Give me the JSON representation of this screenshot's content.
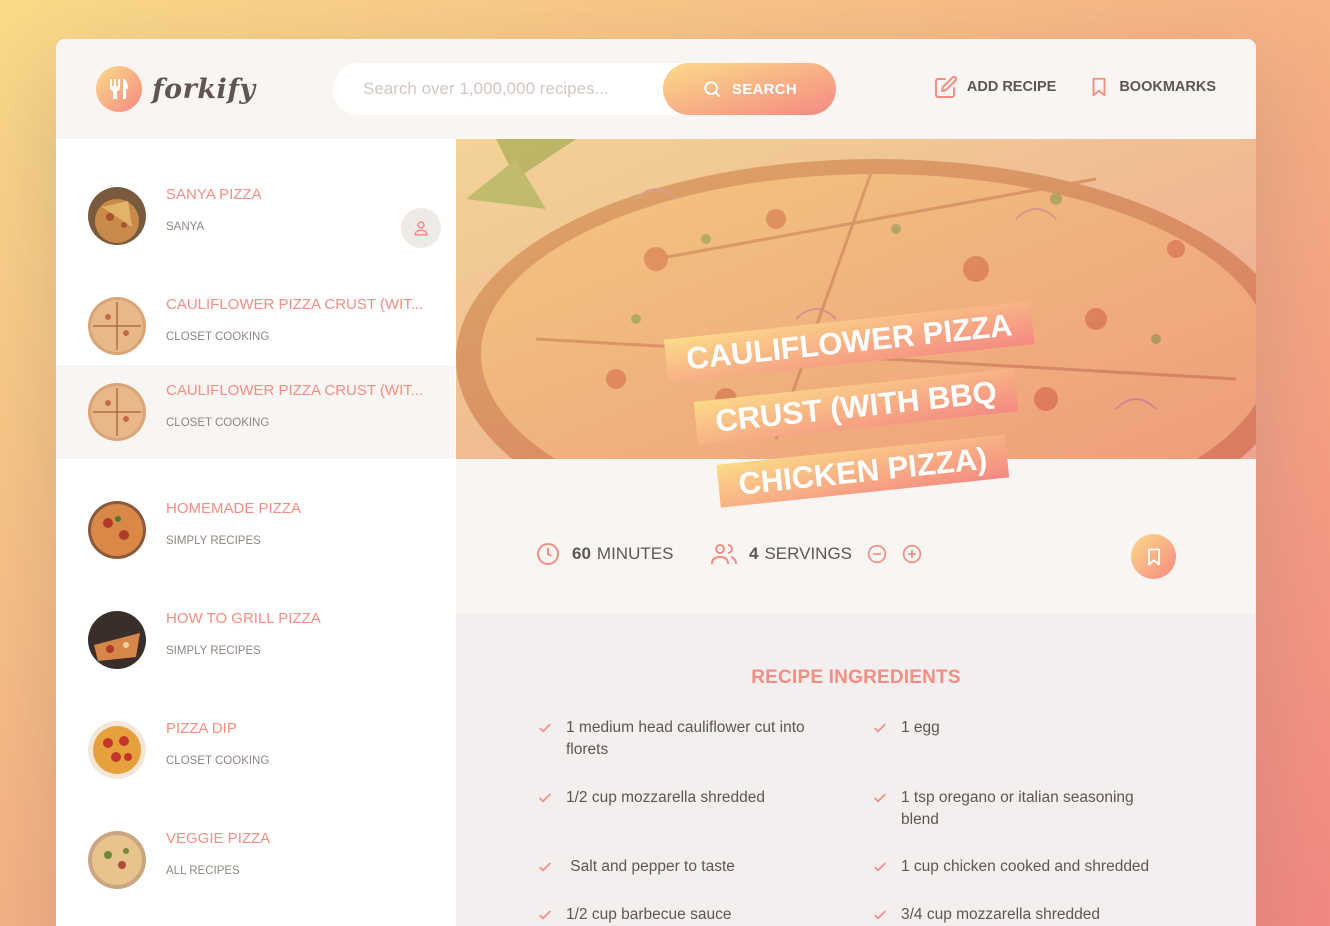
{
  "app": {
    "logo_text": "forkify"
  },
  "search": {
    "placeholder": "Search over 1,000,000 recipes...",
    "button_label": "SEARCH"
  },
  "nav": {
    "add_recipe": "ADD RECIPE",
    "bookmarks": "BOOKMARKS"
  },
  "results": [
    {
      "title": "SANYA PIZZA",
      "publisher": "SANYA",
      "user_generated": true
    },
    {
      "title": "CAULIFLOWER PIZZA CRUST (WIT...",
      "publisher": "CLOSET COOKING"
    },
    {
      "title": "CAULIFLOWER PIZZA CRUST (WIT...",
      "publisher": "CLOSET COOKING",
      "active": true
    },
    {
      "title": "HOMEMADE PIZZA",
      "publisher": "SIMPLY RECIPES"
    },
    {
      "title": "HOW TO GRILL PIZZA",
      "publisher": "SIMPLY RECIPES"
    },
    {
      "title": "PIZZA DIP",
      "publisher": "CLOSET COOKING"
    },
    {
      "title": "VEGGIE PIZZA",
      "publisher": "ALL RECIPES"
    }
  ],
  "recipe": {
    "title_lines": [
      "CAULIFLOWER PIZZA",
      "CRUST (WITH BBQ",
      "CHICKEN PIZZA)"
    ],
    "cooking_time": "60",
    "cooking_time_unit": "MINUTES",
    "servings": "4",
    "servings_unit": "SERVINGS",
    "ingredients_heading": "RECIPE INGREDIENTS",
    "ingredients": [
      "1 medium head cauliflower cut into florets",
      "1 egg",
      "1/2 cup mozzarella shredded",
      "1 tsp oregano or italian seasoning blend",
      " Salt and pepper to taste",
      "1 cup chicken cooked and shredded",
      "1/2 cup barbecue sauce",
      "3/4 cup mozzarella shredded"
    ]
  },
  "colors": {
    "accent": "#f38e82",
    "grad_start": "#fbdb89",
    "grad_end": "#f48982",
    "text": "#615551"
  }
}
